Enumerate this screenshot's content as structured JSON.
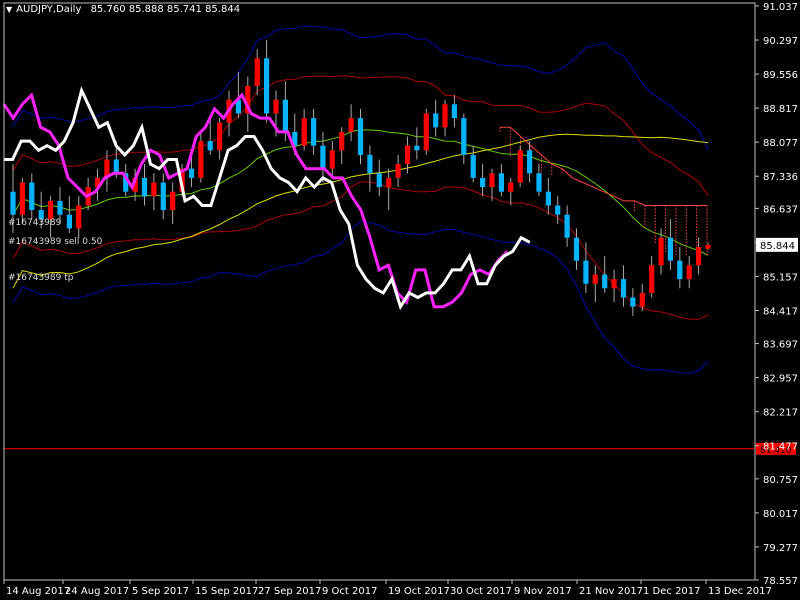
{
  "header": {
    "symbol": "AUDJPY,Daily",
    "ohlc": "85.760 85.888 85.741 85.844"
  },
  "orders": {
    "label_entry": "#16743989",
    "label_sell": "#16743989 sell 0.50",
    "label_tp": "#16743989 tp"
  },
  "colors": {
    "background": "#000000",
    "grid_frame": "#c0c0c0",
    "bull_candle": "#ff0000",
    "bear_candle": "#00b4ff",
    "tenkan": "#ff22ff",
    "kijun": "#ffffff",
    "bb_outer": "#0000aa",
    "bb_mid": "#aa0000",
    "ma_yellow": "#dddd00",
    "ma_green": "#66cc00",
    "cloud": "#ff4444",
    "price_line": "#ff0000"
  },
  "chart_data": {
    "type": "candlestick",
    "symbol": "AUDJPY",
    "timeframe": "Daily",
    "y_ticks": [
      "91.037",
      "90.297",
      "89.556",
      "88.817",
      "88.077",
      "87.336",
      "86.637",
      "85.897",
      "85.157",
      "84.417",
      "83.697",
      "82.957",
      "82.217",
      "81.477",
      "80.757",
      "80.017",
      "79.277",
      "78.557"
    ],
    "y_range": [
      78.557,
      91.037
    ],
    "x_ticks": [
      "14 Aug 2017",
      "24 Aug 2017",
      "5 Sep 2017",
      "15 Sep 2017",
      "27 Sep 2017",
      "9 Oct 2017",
      "19 Oct 2017",
      "30 Oct 2017",
      "9 Nov 2017",
      "21 Nov 2017",
      "1 Dec 2017",
      "13 Dec 2017"
    ],
    "current_price": "85.844",
    "price_line_label": "81.410",
    "price_line_value": 81.41,
    "candles": [
      [
        87.0,
        87.6,
        86.1,
        86.5
      ],
      [
        86.5,
        87.3,
        86.3,
        87.2
      ],
      [
        87.2,
        87.4,
        86.4,
        86.6
      ],
      [
        86.6,
        87.0,
        86.2,
        86.4
      ],
      [
        86.4,
        86.9,
        86.0,
        86.8
      ],
      [
        86.8,
        87.1,
        86.3,
        86.5
      ],
      [
        86.5,
        86.9,
        86.1,
        86.2
      ],
      [
        86.2,
        86.9,
        86.0,
        86.7
      ],
      [
        86.7,
        87.3,
        86.6,
        87.1
      ],
      [
        87.1,
        87.5,
        86.8,
        87.3
      ],
      [
        87.3,
        87.9,
        87.0,
        87.7
      ],
      [
        87.7,
        88.1,
        87.3,
        87.4
      ],
      [
        87.4,
        87.6,
        86.9,
        87.0
      ],
      [
        87.0,
        87.5,
        86.8,
        87.3
      ],
      [
        87.3,
        87.6,
        86.7,
        86.9
      ],
      [
        86.9,
        87.4,
        86.6,
        87.2
      ],
      [
        87.2,
        87.4,
        86.4,
        86.6
      ],
      [
        86.6,
        87.2,
        86.3,
        87.0
      ],
      [
        87.0,
        87.6,
        86.9,
        87.5
      ],
      [
        87.5,
        87.9,
        87.1,
        87.3
      ],
      [
        87.3,
        88.3,
        87.2,
        88.1
      ],
      [
        88.1,
        88.6,
        87.8,
        87.9
      ],
      [
        87.9,
        88.6,
        87.7,
        88.5
      ],
      [
        88.5,
        89.2,
        88.2,
        89.0
      ],
      [
        89.0,
        89.6,
        88.6,
        88.7
      ],
      [
        88.7,
        89.5,
        88.3,
        89.3
      ],
      [
        89.3,
        90.1,
        89.1,
        89.9
      ],
      [
        89.9,
        90.3,
        88.5,
        88.7
      ],
      [
        88.7,
        89.2,
        88.2,
        89.0
      ],
      [
        89.0,
        89.4,
        88.1,
        88.3
      ],
      [
        88.3,
        88.7,
        87.8,
        88.0
      ],
      [
        88.0,
        88.8,
        87.9,
        88.6
      ],
      [
        88.6,
        88.8,
        87.8,
        88.0
      ],
      [
        88.0,
        88.3,
        87.2,
        87.5
      ],
      [
        87.5,
        88.1,
        87.3,
        87.9
      ],
      [
        87.9,
        88.4,
        87.6,
        88.3
      ],
      [
        88.3,
        88.9,
        88.1,
        88.6
      ],
      [
        88.6,
        88.8,
        87.6,
        87.8
      ],
      [
        87.8,
        88.0,
        87.0,
        87.4
      ],
      [
        87.4,
        87.7,
        86.9,
        87.1
      ],
      [
        87.1,
        87.5,
        86.6,
        87.3
      ],
      [
        87.3,
        87.8,
        87.1,
        87.6
      ],
      [
        87.6,
        88.2,
        87.4,
        88.0
      ],
      [
        88.0,
        88.4,
        87.7,
        87.9
      ],
      [
        87.9,
        88.8,
        87.8,
        88.7
      ],
      [
        88.7,
        89.0,
        88.2,
        88.4
      ],
      [
        88.4,
        89.0,
        88.2,
        88.9
      ],
      [
        88.9,
        89.1,
        88.4,
        88.6
      ],
      [
        88.6,
        88.7,
        87.6,
        87.8
      ],
      [
        87.8,
        88.0,
        87.2,
        87.3
      ],
      [
        87.3,
        87.6,
        86.9,
        87.1
      ],
      [
        87.1,
        87.5,
        86.8,
        87.4
      ],
      [
        87.4,
        87.6,
        86.9,
        87.0
      ],
      [
        87.0,
        87.3,
        86.7,
        87.2
      ],
      [
        87.2,
        88.0,
        87.1,
        87.9
      ],
      [
        87.9,
        88.1,
        87.2,
        87.4
      ],
      [
        87.4,
        87.6,
        86.9,
        87.0
      ],
      [
        87.0,
        87.3,
        86.5,
        86.7
      ],
      [
        86.7,
        86.9,
        86.3,
        86.5
      ],
      [
        86.5,
        86.7,
        85.8,
        86.0
      ],
      [
        86.0,
        86.2,
        85.3,
        85.5
      ],
      [
        85.5,
        85.9,
        84.8,
        85.0
      ],
      [
        85.0,
        85.4,
        84.6,
        85.2
      ],
      [
        85.2,
        85.6,
        84.8,
        84.9
      ],
      [
        84.9,
        85.3,
        84.6,
        85.1
      ],
      [
        85.1,
        85.4,
        84.5,
        84.7
      ],
      [
        84.7,
        84.9,
        84.3,
        84.5
      ],
      [
        84.5,
        85.0,
        84.4,
        84.8
      ],
      [
        84.8,
        85.6,
        84.7,
        85.4
      ],
      [
        85.4,
        86.2,
        85.2,
        86.0
      ],
      [
        86.0,
        86.4,
        85.3,
        85.5
      ],
      [
        85.5,
        85.8,
        84.9,
        85.1
      ],
      [
        85.1,
        85.6,
        84.9,
        85.4
      ],
      [
        85.4,
        86.0,
        85.2,
        85.8
      ],
      [
        85.76,
        85.888,
        85.741,
        85.844
      ]
    ],
    "tenkan": [
      88.9,
      88.6,
      88.9,
      89.1,
      88.4,
      88.3,
      88.0,
      87.3,
      87.1,
      86.9,
      87.0,
      87.3,
      87.4,
      87.4,
      87.1,
      87.6,
      87.9,
      87.8,
      87.3,
      87.4,
      87.5,
      88.2,
      88.4,
      88.8,
      88.6,
      88.9,
      89.1,
      88.7,
      88.6,
      88.6,
      88.3,
      88.3,
      87.8,
      87.5,
      87.5,
      87.5,
      87.3,
      87.3,
      86.9,
      86.6,
      86.0,
      85.3,
      85.4,
      84.8,
      84.6,
      85.3,
      85.3,
      84.5,
      84.5,
      84.6,
      84.8,
      85.2,
      85.3,
      85.2,
      85.5,
      85.7
    ],
    "kijun": [
      87.7,
      87.7,
      88.1,
      88.1,
      87.9,
      88.0,
      87.9,
      88.1,
      88.5,
      89.2,
      88.8,
      88.4,
      88.5,
      88.0,
      87.8,
      88.0,
      88.4,
      87.6,
      87.5,
      87.7,
      87.7,
      86.8,
      86.9,
      86.7,
      86.7,
      87.3,
      87.9,
      88.0,
      88.2,
      88.2,
      87.9,
      87.5,
      87.3,
      87.2,
      87.0,
      87.3,
      87.1,
      87.3,
      87.2,
      86.6,
      86.3,
      85.4,
      85.1,
      84.9,
      84.8,
      85.1,
      84.5,
      84.8,
      84.7,
      84.8,
      84.8,
      85.0,
      85.3,
      85.3,
      85.6,
      85.0,
      85.0,
      85.4,
      85.6,
      85.7,
      86.0,
      85.9
    ],
    "indicators": [
      "Bollinger Bands",
      "Ichimoku",
      "Moving Averages"
    ]
  }
}
